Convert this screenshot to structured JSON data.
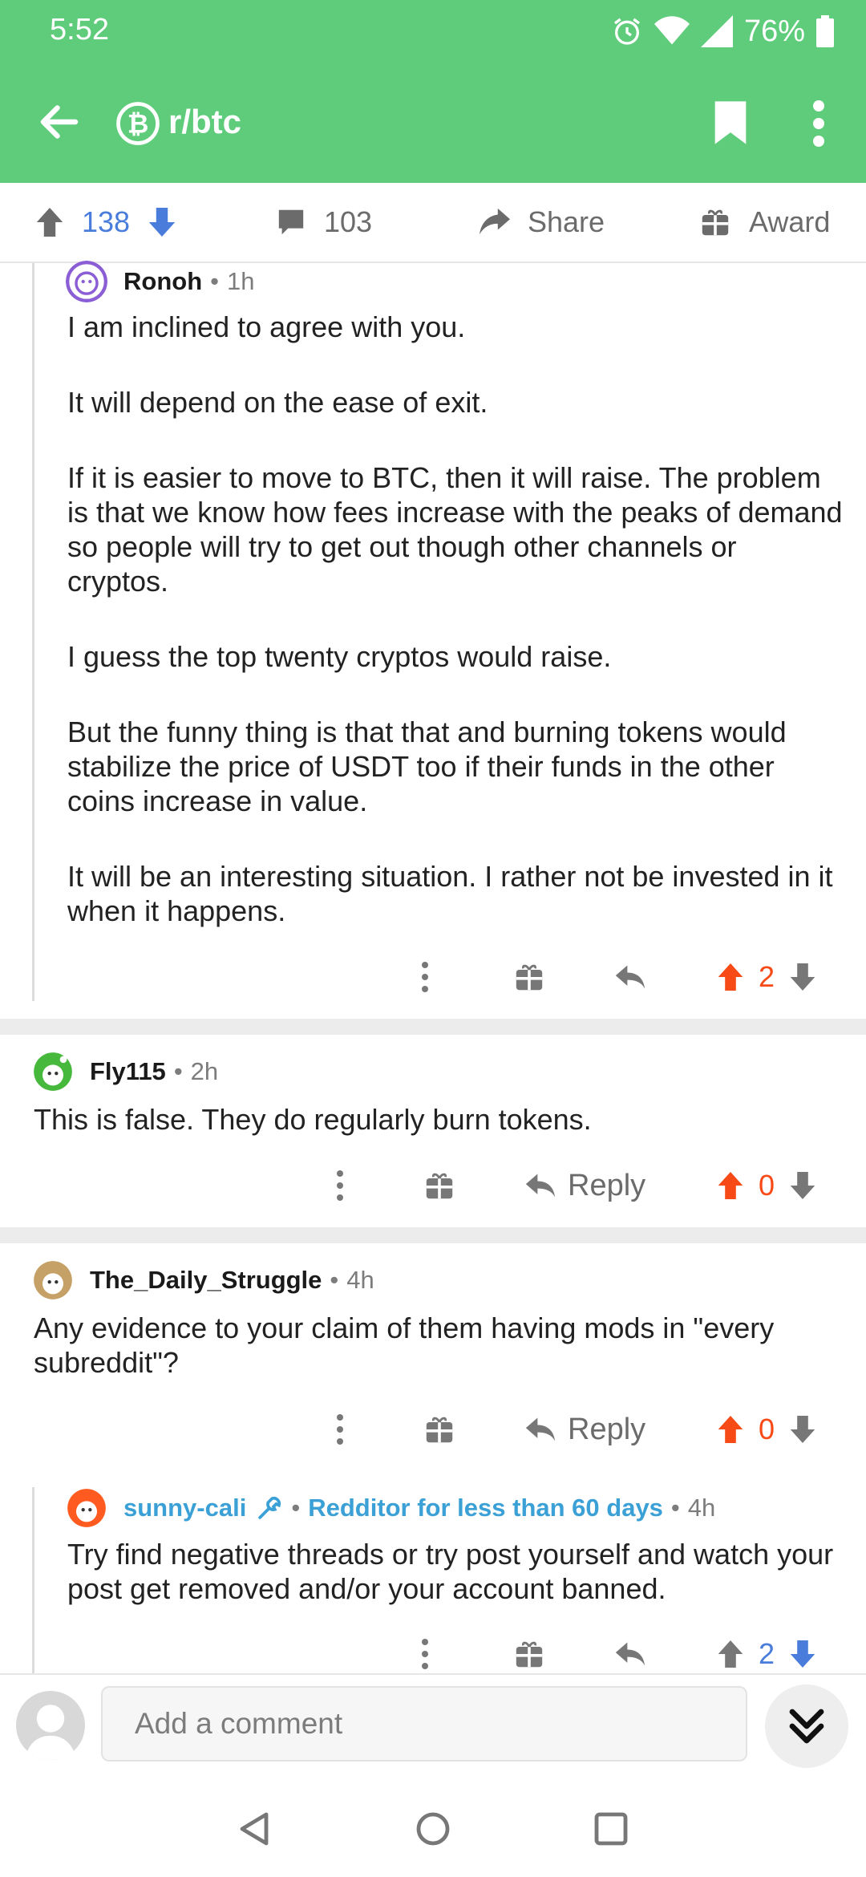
{
  "status": {
    "time": "5:52",
    "battery": "76%"
  },
  "header": {
    "subreddit": "r/btc"
  },
  "actions": {
    "score": "138",
    "comments": "103",
    "share": "Share",
    "award": "Award"
  },
  "comments": [
    {
      "author": "Ronoh",
      "age": "1h",
      "paragraphs": [
        "I am inclined to agree with you.",
        "It will depend on the ease of exit.",
        "If it is easier to move to BTC, then it will raise. The problem is that we know how fees increase with the peaks of demand so people will try to get out though other channels or cryptos.",
        "I guess the top twenty cryptos would raise.",
        "But the funny thing is that that and burning tokens would stabilize the price of USDT too if their funds in the other coins increase in value.",
        "It will be an interesting situation. I rather not be invested in it when it happens."
      ],
      "score": "2"
    },
    {
      "author": "Fly115",
      "age": "2h",
      "text": "This is false. They do regularly burn tokens.",
      "reply_label": "Reply",
      "score": "0"
    },
    {
      "author": "The_Daily_Struggle",
      "age": "4h",
      "text": "Any evidence to your claim of them having mods in \"every subreddit\"?",
      "reply_label": "Reply",
      "score": "0"
    },
    {
      "author": "sunny-cali",
      "badge": "Redditor for less than 60 days",
      "age": "4h",
      "text": "Try find negative threads or try post yourself and watch your post get removed and/or your account banned.",
      "score": "2"
    }
  ],
  "composer": {
    "placeholder": "Add a comment"
  },
  "colors": {
    "header": "#5ECC7A",
    "upvote": "#f74a16",
    "downvote": "#4a7ddb",
    "mod": "#3aa0d6"
  },
  "icons": [
    "back-arrow-icon",
    "bitcoin-icon",
    "bookmark-icon",
    "more-vertical-icon",
    "upvote-icon",
    "downvote-icon",
    "comment-icon",
    "share-icon",
    "gift-icon",
    "reply-icon",
    "chevron-double-down-icon"
  ]
}
